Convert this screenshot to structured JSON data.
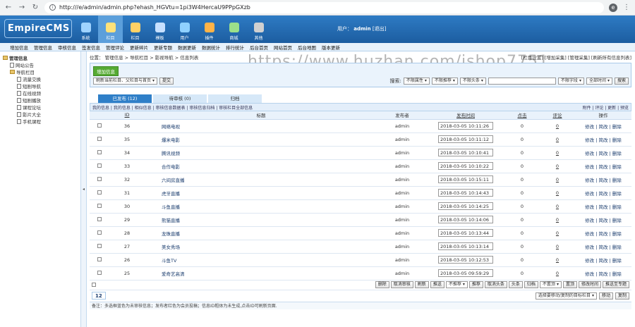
{
  "browser": {
    "url": "http:///e/admin/admin.php?ehash_HGVtu=1pi3W4HercaU9PPpGXzb",
    "avatar_letter": "e"
  },
  "header": {
    "logo": "EmpireCMS",
    "modules": [
      {
        "label": "系统",
        "color": "#9fd3ff"
      },
      {
        "label": "栏目",
        "color": "#ffe27a"
      },
      {
        "label": "栏目",
        "color": "#ffd166"
      },
      {
        "label": "模板",
        "color": "#c7e0ff"
      },
      {
        "label": "用户",
        "color": "#8fd1ff"
      },
      {
        "label": "插件",
        "color": "#ffb347"
      },
      {
        "label": "商城",
        "color": "#9be08a"
      },
      {
        "label": "其他",
        "color": "#d0d0d0"
      }
    ],
    "user_label": "用户：",
    "user_name": "admin",
    "logout": "[退出]"
  },
  "menu": [
    "增加信息",
    "管理信息",
    "审核信息",
    "签发信息",
    "管理评论",
    "更新碎片",
    "更新专题",
    "数据更新",
    "数据统计",
    "排行统计",
    "后台首页",
    "网站首页",
    "后台地图",
    "版本更新"
  ],
  "sidebar": {
    "root": "管理信息",
    "items": [
      "网站公告",
      "导航栏目",
      "流量交换",
      "短剧导航",
      "在线视频",
      "短剧播放",
      "课程论坛",
      "影片大全",
      "手机课程"
    ]
  },
  "position": {
    "label": "位置：",
    "path": "管理信息 > 导航栏目 > 影视导航 > 信息列表",
    "links": [
      "[栏目设置]",
      "[增加采集]",
      "[管理采集]",
      "[刷新所有信息列表]"
    ]
  },
  "toolbox": {
    "add_button": "增加信息",
    "refresh_select": "刷新当前栏目、父栏目与首页",
    "submit": "提交",
    "search_label": "搜索:",
    "filters": [
      "不限属性",
      "不限推荐",
      "不限头条"
    ],
    "search_placeholder": "",
    "field_select": "不限字段",
    "time_select": "全部时间",
    "search_button": "搜索"
  },
  "tabs": [
    "已发布 (12)",
    "待审核 (0)",
    "归档"
  ],
  "subbar": {
    "left": "我的信息 | 我的信息 | 相似信息 | 审核信息数据表 | 审核信息归档 | 审核栏目全部信息",
    "right": "附件 | 评论 | 更新 | 预览"
  },
  "table": {
    "headers": [
      "ID",
      "标题",
      "发布者",
      "发布时间",
      "点击",
      "评论",
      "操作"
    ],
    "ops": "修改 | 简改 | 删除",
    "rows": [
      {
        "id": "36",
        "title": "网络电视",
        "author": "admin",
        "time": "2018-03-05 10:11:26",
        "clicks": "0",
        "comments": "0"
      },
      {
        "id": "35",
        "title": "爆米电影",
        "author": "admin",
        "time": "2018-03-05 10:11:12",
        "clicks": "0",
        "comments": "0"
      },
      {
        "id": "34",
        "title": "腾讯视频",
        "author": "admin",
        "time": "2018-03-05 10:10:41",
        "clicks": "0",
        "comments": "0"
      },
      {
        "id": "33",
        "title": "合作电影",
        "author": "admin",
        "time": "2018-03-05 10:10:22",
        "clicks": "0",
        "comments": "0"
      },
      {
        "id": "32",
        "title": "六间房直播",
        "author": "admin",
        "time": "2018-03-05 10:15:11",
        "clicks": "0",
        "comments": "0"
      },
      {
        "id": "31",
        "title": "虎牙直播",
        "author": "admin",
        "time": "2018-03-05 10:14:43",
        "clicks": "0",
        "comments": "0"
      },
      {
        "id": "30",
        "title": "斗鱼直播",
        "author": "admin",
        "time": "2018-03-05 10:14:25",
        "clicks": "0",
        "comments": "0"
      },
      {
        "id": "29",
        "title": "熊猫直播",
        "author": "admin",
        "time": "2018-03-05 10:14:06",
        "clicks": "0",
        "comments": "0"
      },
      {
        "id": "28",
        "title": "龙珠直播",
        "author": "admin",
        "time": "2018-03-05 10:13:44",
        "clicks": "0",
        "comments": "0"
      },
      {
        "id": "27",
        "title": "美女秀场",
        "author": "admin",
        "time": "2018-03-05 10:13:14",
        "clicks": "0",
        "comments": "0"
      },
      {
        "id": "26",
        "title": "斗鱼TV",
        "author": "admin",
        "time": "2018-03-05 10:12:53",
        "clicks": "0",
        "comments": "0"
      },
      {
        "id": "25",
        "title": "爱奇艺高清",
        "author": "admin",
        "time": "2018-03-05 09:59:29",
        "clicks": "0",
        "comments": "0"
      }
    ]
  },
  "actions": {
    "buttons": [
      "删除",
      "取消审核",
      "刷新",
      "推送"
    ],
    "recommend_select": "不推荐",
    "buttons2": [
      "推荐",
      "取消头条",
      "头条",
      "归档"
    ],
    "top_select": "不置顶",
    "buttons3": [
      "置顶",
      "修改时间",
      "推送至专题"
    ]
  },
  "pager": {
    "count": "12",
    "move_select": "选择要移动/复制的目标栏目",
    "move": "移动",
    "copy": "复制"
  },
  "note": "备注：多选框蓝色为未审核信息；发布者红色为会员投稿；信息ID粗体为未生成,点击ID可刷新页面.",
  "watermark": "https://www.huzhan.com/ishop7751"
}
